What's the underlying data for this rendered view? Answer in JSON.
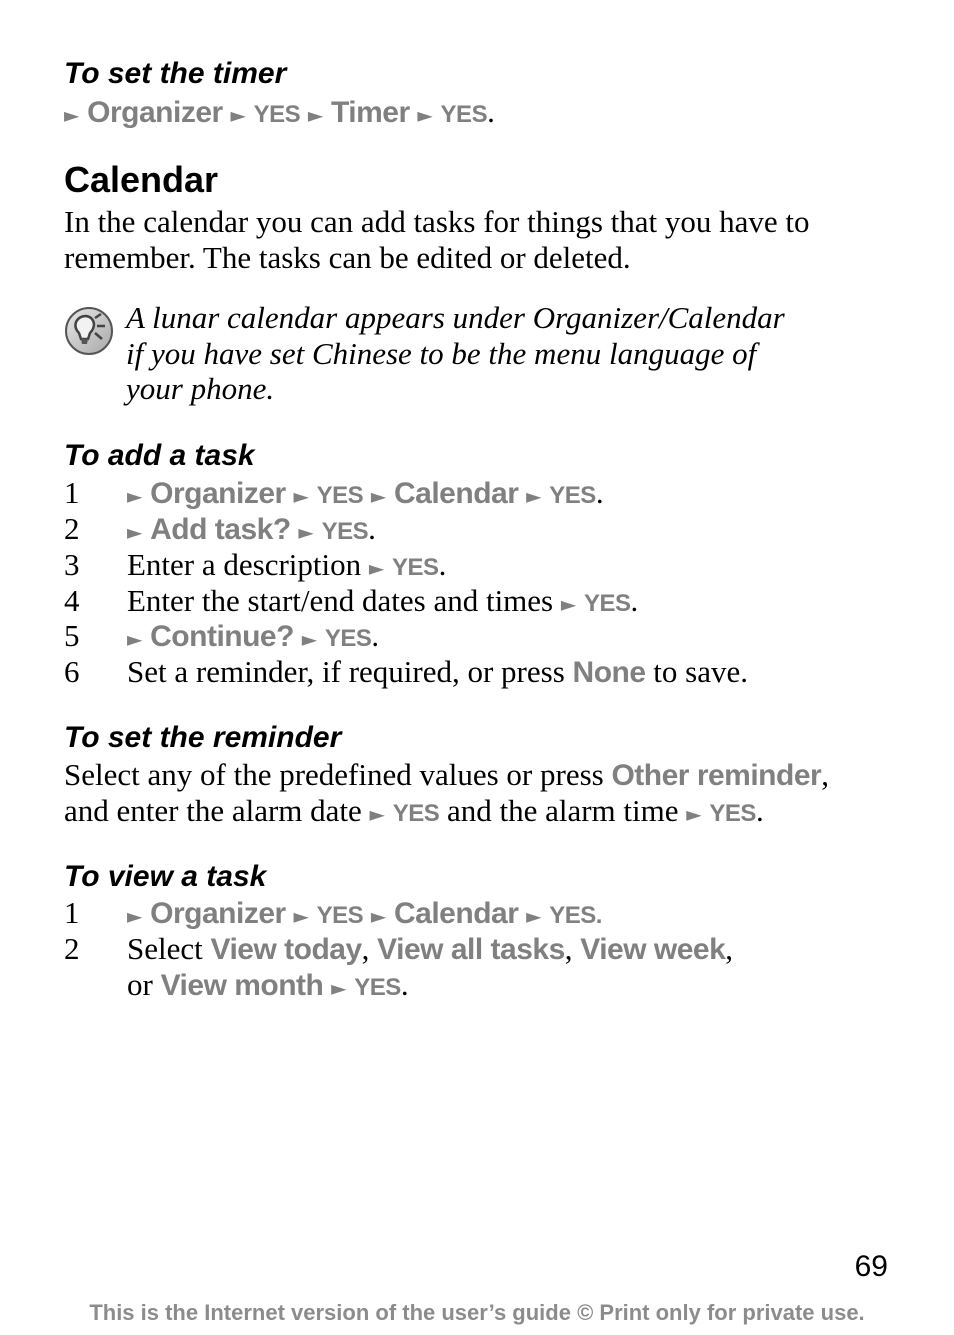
{
  "timer": {
    "heading": "To set the timer",
    "path": [
      "Organizer",
      "YES",
      "Timer",
      "YES"
    ],
    "end": "."
  },
  "calendar": {
    "title": "Calendar",
    "intro_lines": [
      "In the calendar you can add tasks for things that you have to",
      "remember. The tasks can be edited or deleted."
    ],
    "tip": {
      "icon": "lightbulb-tip-icon",
      "lines": [
        "A lunar calendar appears under Organizer/Calendar",
        "if you have set Chinese to be the menu language of",
        "your phone."
      ]
    }
  },
  "add_task": {
    "heading": "To add a task",
    "steps": [
      {
        "num": "1",
        "path": [
          "Organizer",
          "YES",
          "Calendar",
          "YES"
        ],
        "end": "."
      },
      {
        "num": "2",
        "path": [
          "Add task?",
          "YES"
        ],
        "end": "."
      },
      {
        "num": "3",
        "text": "Enter a description",
        "path": [
          "YES"
        ],
        "end": "."
      },
      {
        "num": "4",
        "text": "Enter the start/end dates and times",
        "path": [
          "YES"
        ],
        "end": "."
      },
      {
        "num": "5",
        "path": [
          "Continue?",
          "YES"
        ],
        "end": "."
      },
      {
        "num": "6",
        "text_before": "Set a reminder, if required, or press",
        "key": "None",
        "text_after": "to save."
      }
    ]
  },
  "reminder": {
    "heading": "To set the reminder",
    "line1_text": "Select any of the predefined values or press",
    "line1_key": "Other reminder",
    "line1_end": ",",
    "line2_text1": "and enter the alarm date",
    "line2_yes1": "YES",
    "line2_text2": "and the alarm time",
    "line2_yes2": "YES",
    "line2_end": "."
  },
  "view_task": {
    "heading": "To view a task",
    "steps": [
      {
        "num": "1",
        "path": [
          "Organizer",
          "YES",
          "Calendar",
          "YES."
        ]
      },
      {
        "num": "2",
        "text": "Select",
        "options": [
          "View today",
          "View all tasks",
          "View week"
        ],
        "line2_or": "or",
        "last_option": "View month",
        "yes": "YES",
        "end": "."
      }
    ]
  },
  "page_number": "69",
  "footer": "This is the Internet version of the user’s guide © Print only for private use.",
  "colors": {
    "menu_text": "#808080",
    "body_text": "#000000",
    "footer_text": "#8c8c8c"
  }
}
